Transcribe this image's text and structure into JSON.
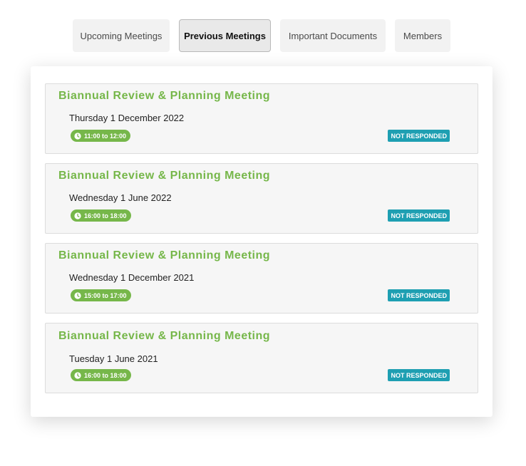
{
  "tabs": [
    {
      "label": "Upcoming Meetings",
      "active": false
    },
    {
      "label": "Previous Meetings",
      "active": true
    },
    {
      "label": "Important Documents",
      "active": false
    },
    {
      "label": "Members",
      "active": false
    }
  ],
  "meetings": [
    {
      "title": "Biannual Review & Planning Meeting",
      "date": "Thursday 1 December 2022",
      "time": "11:00 to 12:00",
      "status": "NOT RESPONDED"
    },
    {
      "title": "Biannual Review & Planning Meeting",
      "date": "Wednesday 1 June 2022",
      "time": "16:00 to 18:00",
      "status": "NOT RESPONDED"
    },
    {
      "title": "Biannual Review & Planning Meeting",
      "date": "Wednesday 1 December 2021",
      "time": "15:00 to 17:00",
      "status": "NOT RESPONDED"
    },
    {
      "title": "Biannual Review & Planning Meeting",
      "date": "Tuesday 1 June 2021",
      "time": "16:00 to 18:00",
      "status": "NOT RESPONDED"
    }
  ],
  "icons": {
    "time": "clock-icon"
  },
  "colors": {
    "accent_green": "#76b74a",
    "status_teal": "#1e9fb2",
    "tab_background": "#f2f2f2"
  }
}
